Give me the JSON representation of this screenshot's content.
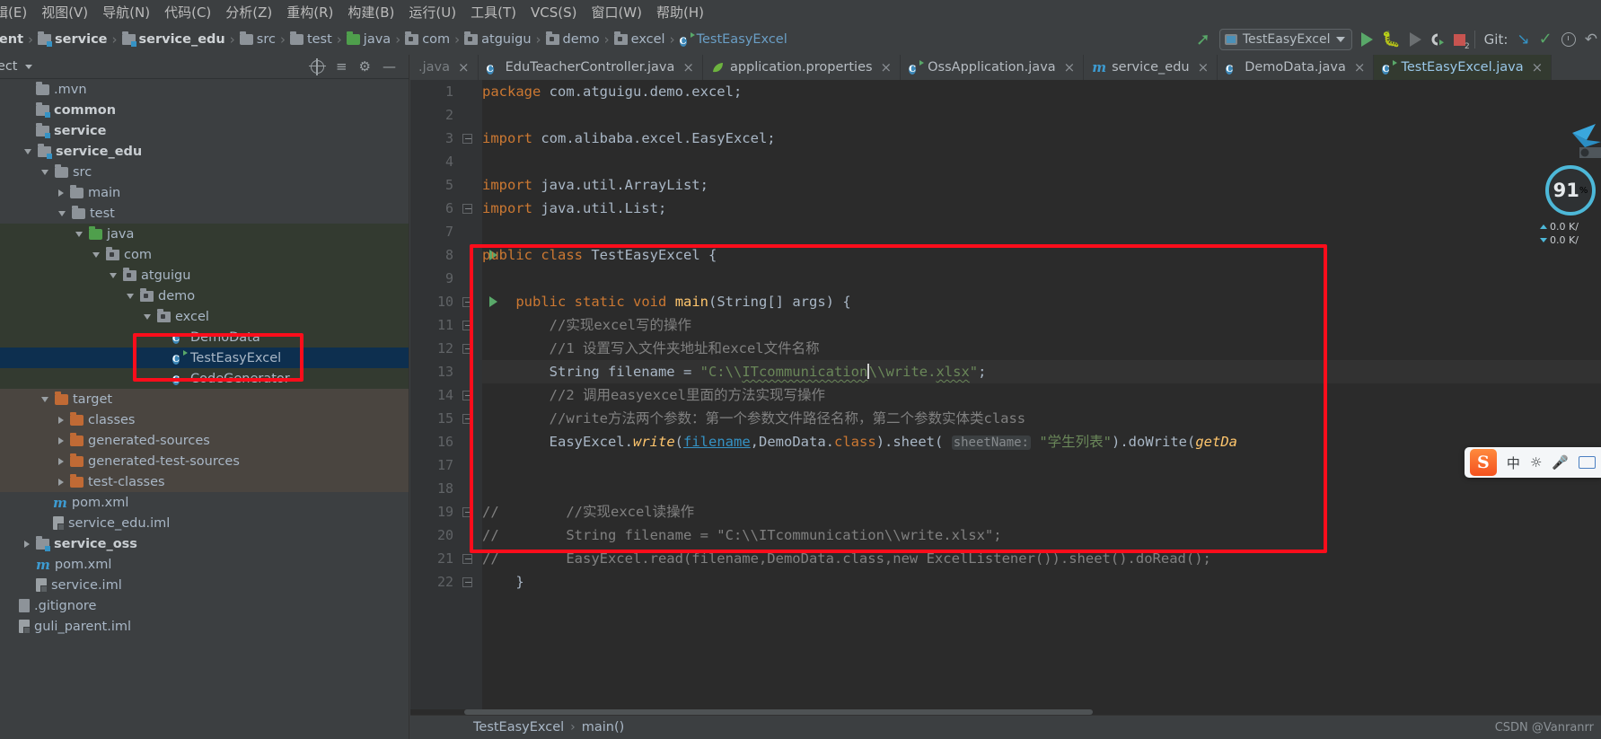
{
  "menu": {
    "items": [
      "辑(E)",
      "视图(V)",
      "导航(N)",
      "代码(C)",
      "分析(Z)",
      "重构(R)",
      "构建(B)",
      "运行(U)",
      "工具(T)",
      "VCS(S)",
      "窗口(W)",
      "帮助(H)"
    ]
  },
  "breadcrumb": {
    "items": [
      {
        "label": "arent",
        "icon": "none",
        "style": "bold"
      },
      {
        "label": "service",
        "icon": "module",
        "style": "bold"
      },
      {
        "label": "service_edu",
        "icon": "module",
        "style": "bold"
      },
      {
        "label": "src",
        "icon": "folder",
        "style": "plain"
      },
      {
        "label": "test",
        "icon": "folder",
        "style": "plain"
      },
      {
        "label": "java",
        "icon": "folder-green",
        "style": "plain"
      },
      {
        "label": "com",
        "icon": "package",
        "style": "plain"
      },
      {
        "label": "atguigu",
        "icon": "package",
        "style": "plain"
      },
      {
        "label": "demo",
        "icon": "package",
        "style": "plain"
      },
      {
        "label": "excel",
        "icon": "package",
        "style": "plain"
      },
      {
        "label": "TestEasyExcel",
        "icon": "class-runnable",
        "style": "blue"
      }
    ]
  },
  "toolbar": {
    "hammer_icon": "build-hammer-icon",
    "run_config_label": "TestEasyExcel",
    "run_icon": "run-icon",
    "debug_icon": "debug-icon",
    "run_with_coverage_icon": "run-coverage-icon",
    "profile_icon": "profile-icon",
    "stop_icon": "stop-icon",
    "stop_badge": "2",
    "git_label": "Git:",
    "git_update_icon": "update-project-icon",
    "git_commit_icon": "commit-icon",
    "git_history_icon": "history-icon",
    "git_rollback_icon": "rollback-icon"
  },
  "project_panel": {
    "title": "oject",
    "locate_icon": "locate-file-icon",
    "collapse_icon": "collapse-all-icon",
    "settings_icon": "gear-icon",
    "hide_icon": "hide-panel-icon",
    "tree": [
      {
        "label": ".mvn",
        "depth": 0,
        "icon": "folder",
        "twisty": "none",
        "style": "plain",
        "bg": "dark"
      },
      {
        "label": "common",
        "depth": 0,
        "icon": "module",
        "twisty": "none",
        "style": "bold",
        "bg": "dark"
      },
      {
        "label": "service",
        "depth": 0,
        "icon": "module",
        "twisty": "none",
        "style": "bold",
        "bg": "dark"
      },
      {
        "label": "service_edu",
        "depth": 0,
        "icon": "module",
        "twisty": "down",
        "style": "bold",
        "bg": "dark"
      },
      {
        "label": "src",
        "depth": 1,
        "icon": "folder",
        "twisty": "down",
        "style": "plain",
        "bg": "dark"
      },
      {
        "label": "main",
        "depth": 2,
        "icon": "folder",
        "twisty": "right",
        "style": "plain",
        "bg": "dark"
      },
      {
        "label": "test",
        "depth": 2,
        "icon": "folder",
        "twisty": "down",
        "style": "plain",
        "bg": "dark"
      },
      {
        "label": "java",
        "depth": 3,
        "icon": "folder-green",
        "twisty": "down",
        "style": "plain",
        "bg": "green"
      },
      {
        "label": "com",
        "depth": 4,
        "icon": "package",
        "twisty": "down",
        "style": "plain",
        "bg": "green"
      },
      {
        "label": "atguigu",
        "depth": 5,
        "icon": "package",
        "twisty": "down",
        "style": "plain",
        "bg": "green"
      },
      {
        "label": "demo",
        "depth": 6,
        "icon": "package",
        "twisty": "down",
        "style": "plain",
        "bg": "green"
      },
      {
        "label": "excel",
        "depth": 7,
        "icon": "package",
        "twisty": "down",
        "style": "plain",
        "bg": "green"
      },
      {
        "label": "DemoData",
        "depth": 8,
        "icon": "class",
        "twisty": "none",
        "style": "plain",
        "bg": "green"
      },
      {
        "label": "TestEasyExcel",
        "depth": 8,
        "icon": "class-runnable",
        "twisty": "none",
        "style": "plain",
        "bg": "selected"
      },
      {
        "label": "CodeGenerator",
        "depth": 8,
        "icon": "class",
        "twisty": "none",
        "style": "plain",
        "bg": "green"
      },
      {
        "label": "target",
        "depth": 1,
        "icon": "folder-orange",
        "twisty": "down",
        "style": "plain",
        "bg": "brown"
      },
      {
        "label": "classes",
        "depth": 2,
        "icon": "folder-orange",
        "twisty": "right",
        "style": "plain",
        "bg": "brown"
      },
      {
        "label": "generated-sources",
        "depth": 2,
        "icon": "folder-orange",
        "twisty": "right",
        "style": "plain",
        "bg": "brown"
      },
      {
        "label": "generated-test-sources",
        "depth": 2,
        "icon": "folder-orange",
        "twisty": "right",
        "style": "plain",
        "bg": "brown"
      },
      {
        "label": "test-classes",
        "depth": 2,
        "icon": "folder-orange",
        "twisty": "right",
        "style": "plain",
        "bg": "brown"
      },
      {
        "label": "pom.xml",
        "depth": 1,
        "icon": "maven",
        "twisty": "none",
        "style": "plain",
        "bg": "dark"
      },
      {
        "label": "service_edu.iml",
        "depth": 1,
        "icon": "iml",
        "twisty": "none",
        "style": "plain",
        "bg": "dark"
      },
      {
        "label": "service_oss",
        "depth": 0,
        "icon": "module",
        "twisty": "right",
        "style": "bold",
        "bg": "dark"
      },
      {
        "label": "pom.xml",
        "depth": 0,
        "icon": "maven",
        "twisty": "none",
        "style": "plain",
        "bg": "dark"
      },
      {
        "label": "service.iml",
        "depth": 0,
        "icon": "iml",
        "twisty": "none",
        "style": "plain",
        "bg": "dark"
      },
      {
        "label": ".gitignore",
        "depth": -1,
        "icon": "gitignore",
        "twisty": "none",
        "style": "plain",
        "bg": "dark"
      },
      {
        "label": "guli_parent.iml",
        "depth": -1,
        "icon": "iml",
        "twisty": "none",
        "style": "plain",
        "bg": "dark"
      }
    ]
  },
  "tabs": [
    {
      "label": ".java",
      "icon": "none",
      "active": false,
      "truncated": true
    },
    {
      "label": "EduTeacherController.java",
      "icon": "class",
      "active": false
    },
    {
      "label": "application.properties",
      "icon": "spring-leaf",
      "active": false
    },
    {
      "label": "OssApplication.java",
      "icon": "class-runnable",
      "active": false
    },
    {
      "label": "service_edu",
      "icon": "maven",
      "active": false
    },
    {
      "label": "DemoData.java",
      "icon": "class",
      "active": false
    },
    {
      "label": "TestEasyExcel.java",
      "icon": "class-runnable",
      "active": true
    }
  ],
  "editor": {
    "lines": [
      {
        "n": 1,
        "text": "package com.atguigu.demo.excel;"
      },
      {
        "n": 2,
        "text": ""
      },
      {
        "n": 3,
        "text": "import com.alibaba.excel.EasyExcel;"
      },
      {
        "n": 4,
        "text": ""
      },
      {
        "n": 5,
        "text": "import java.util.ArrayList;"
      },
      {
        "n": 6,
        "text": "import java.util.List;"
      },
      {
        "n": 7,
        "text": ""
      },
      {
        "n": 8,
        "text": "public class TestEasyExcel {"
      },
      {
        "n": 9,
        "text": ""
      },
      {
        "n": 10,
        "text": "    public static void main(String[] args) {"
      },
      {
        "n": 11,
        "text": "        //实现excel写的操作"
      },
      {
        "n": 12,
        "text": "        //1 设置写入文件夹地址和excel文件名称"
      },
      {
        "n": 13,
        "text": "        String filename = \"C:\\\\ITcommunication\\\\write.xlsx\";"
      },
      {
        "n": 14,
        "text": "        //2 调用easyexcel里面的方法实现写操作"
      },
      {
        "n": 15,
        "text": "        //write方法两个参数：第一个参数文件路径名称，第二个参数实体类class"
      },
      {
        "n": 16,
        "text": "        EasyExcel.write(filename,DemoData.class).sheet( sheetName: \"学生列表\").doWrite(getDa"
      },
      {
        "n": 17,
        "text": ""
      },
      {
        "n": 18,
        "text": ""
      },
      {
        "n": 19,
        "text": "//        //实现excel读操作"
      },
      {
        "n": 20,
        "text": "//        String filename = \"C:\\\\ITcommunication\\\\write.xlsx\";"
      },
      {
        "n": 21,
        "text": "//        EasyExcel.read(filename,DemoData.class,new ExcelListener()).sheet().doRead();"
      },
      {
        "n": 22,
        "text": "    }"
      }
    ],
    "param_hint": "sheetName:"
  },
  "network_widget": {
    "percent": "91",
    "percent_unit": "%",
    "upload": "0.0 K/",
    "download": "0.0 K/"
  },
  "ime": {
    "logo": "S",
    "mode": "中",
    "emoji_icon": "emoji-icon",
    "mic_icon": "microphone-icon",
    "keyboard_icon": "keyboard-icon"
  },
  "statusbar": {
    "class_name": "TestEasyExcel",
    "separator": "›",
    "method_name": "main()",
    "watermark": "CSDN @Vanranrr"
  },
  "colors": {
    "accent_green": "#59a869",
    "accent_blue": "#3592c4",
    "annotation_red": "#fc0d1b",
    "editor_bg": "#2b2b2b",
    "panel_bg": "#3c3f41",
    "selection_blue": "#0d2f4f"
  }
}
